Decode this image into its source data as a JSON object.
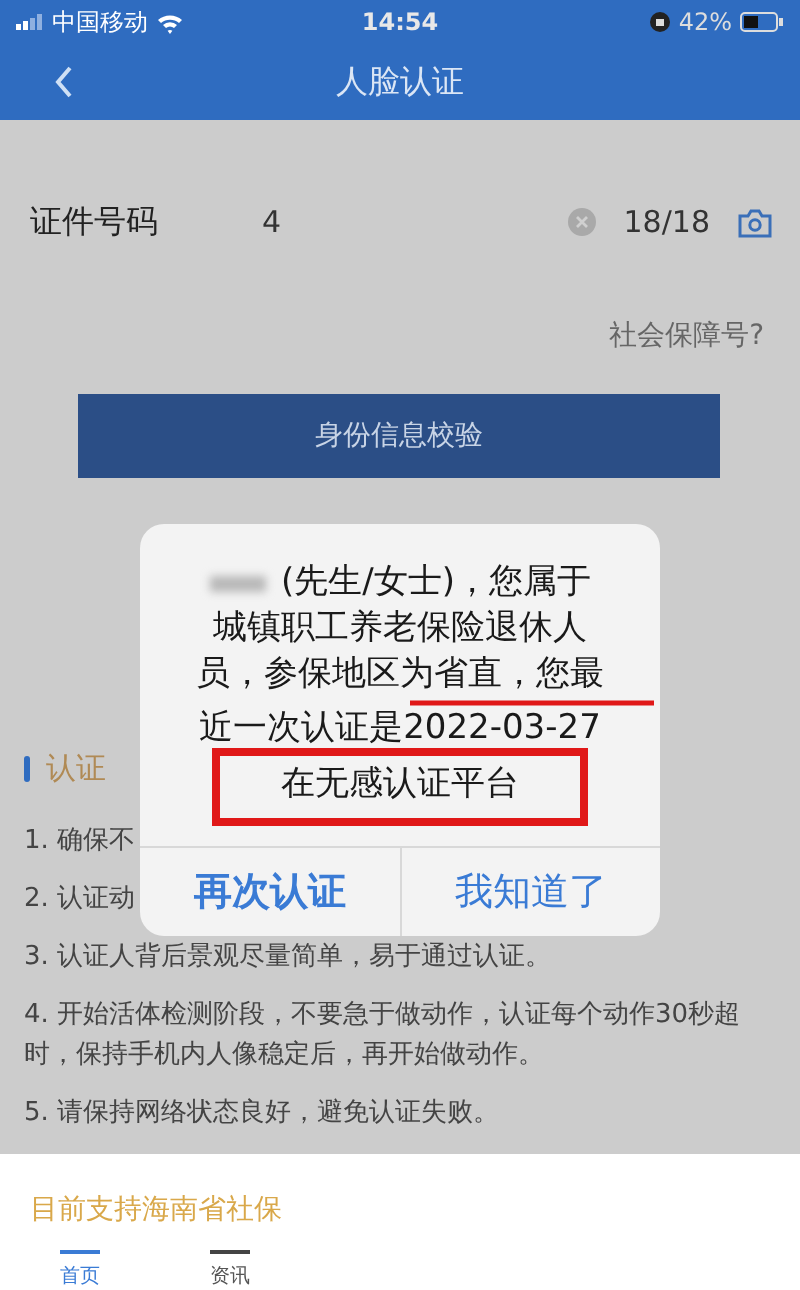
{
  "status_bar": {
    "carrier": "中国移动",
    "time": "14:54",
    "battery": "42%"
  },
  "nav": {
    "title": "人脸认证"
  },
  "id_field": {
    "label": "证件号码",
    "value": "4",
    "counter": "18/18"
  },
  "ssn_link": "社会保障号?",
  "verify_button": "身份信息校验",
  "guide": {
    "heading": "认证",
    "items": [
      "1. 确保不",
      "2. 认证动",
      "3. 认证人背后景观尽量简单，易于通过认证。",
      "4. 开始活体检测阶段，不要急于做动作，认证每个动作30秒超时，保持手机内人像稳定后，再开始做动作。",
      "5. 请保持网络状态良好，避免认证失败。"
    ]
  },
  "dialog": {
    "message_lines": [
      "(先生/女士)，您属于",
      "城镇职工养老保险退休人",
      "员，参保地区为省直，您最",
      "近一次认证是2022-03-27",
      "在无感认证平台"
    ],
    "buttons": [
      "再次认证",
      "我知道了"
    ]
  },
  "notice": "目前支持海南省社保",
  "tabs": [
    {
      "label": "首页",
      "selected": true
    },
    {
      "label": "资讯",
      "selected": false
    }
  ]
}
